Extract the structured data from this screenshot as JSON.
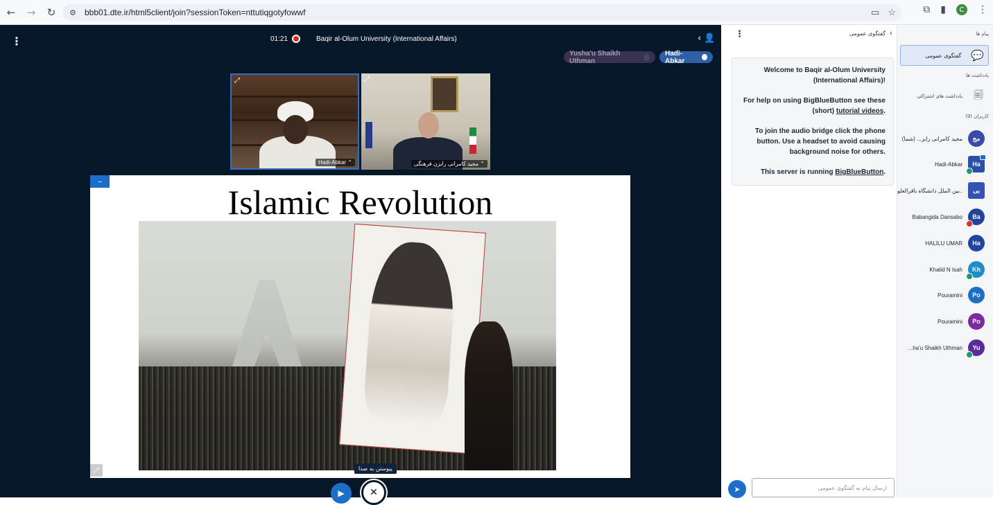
{
  "browser": {
    "url": "bbb01.dte.ir/html5client/join?sessionToken=nttutiqgotyfowwf",
    "profile_initial": "C"
  },
  "meeting": {
    "title": "Baqir al-Olum University (International Affairs)",
    "timer": "01:21"
  },
  "talkers": [
    {
      "name": "Yusha'u Shaikh Uthman"
    },
    {
      "name": "Hadi-Abkar"
    }
  ],
  "videos": [
    {
      "name": "Hadi-Abkar"
    },
    {
      "name": "مجید کامرانی رایزن فرهنگی"
    }
  ],
  "presentation": {
    "slide_title": "Islamic Revolution"
  },
  "controls": {
    "audio_tooltip": "پیوستن به صدا"
  },
  "chat": {
    "title": "گفتگوی عمومی",
    "welcome": {
      "line1": "Welcome to",
      "line1_bold": "Baqir al-Olum University (International Affairs)",
      "line1_end": "!",
      "help_prefix": "For help on using BigBlueButton see these (short)",
      "help_link": "tutorial videos",
      "help_suffix": ".",
      "audio_info": "To join the audio bridge click the phone button. Use a headset to avoid causing background noise for others.",
      "server_prefix": "This server is running",
      "server_link": "BigBlueButton",
      "server_suffix": "."
    },
    "input_placeholder": "ارسال پیام به گفتگوی عمومی"
  },
  "sidebar": {
    "messages_title": "پیام ها",
    "public_chat_label": "گفتگوی عمومی",
    "notes_title": "یادداشت ها",
    "shared_notes_label": "یادداشت های اشتراکی",
    "users_title": "کاربران (9)",
    "users": [
      {
        "name": "مجید کامرانی رایز... (شما)",
        "initials": "مج",
        "color": "#3a4aa8",
        "square": false,
        "badge": "",
        "cam": false
      },
      {
        "name": "Hadi-Abkar",
        "initials": "Ha",
        "color": "#2b4ea8",
        "square": true,
        "badge": "#1a9b6f",
        "cam": true
      },
      {
        "name": "بین الملل دانشگاه باقرالعلو...",
        "initials": "بی",
        "color": "#3352b3",
        "square": true,
        "badge": "",
        "cam": false
      },
      {
        "name": "Babangida Dansabo",
        "initials": "Ba",
        "color": "#23429a",
        "square": false,
        "badge": "#d9342b",
        "cam": false
      },
      {
        "name": "HALILU UMAR",
        "initials": "Ha",
        "color": "#21449e",
        "square": false,
        "badge": "",
        "cam": false
      },
      {
        "name": "Khalid N Isah",
        "initials": "Kh",
        "color": "#1f8bc7",
        "square": false,
        "badge": "#1a9b6f",
        "cam": false
      },
      {
        "name": "Pouramini",
        "initials": "Po",
        "color": "#1d6fc1",
        "square": false,
        "badge": "",
        "cam": false
      },
      {
        "name": "Pouramini",
        "initials": "Po",
        "color": "#7b2aa0",
        "square": false,
        "badge": "",
        "cam": false
      },
      {
        "name": "...ha'u Shaikh Uthman",
        "initials": "Yu",
        "color": "#5a2b9c",
        "square": false,
        "badge": "#1a9b6f",
        "cam": false
      }
    ]
  }
}
